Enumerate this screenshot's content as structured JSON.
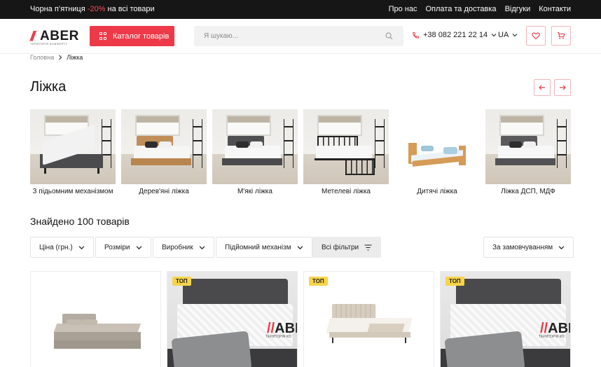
{
  "topbar": {
    "promo_prefix": "Чорна п’ятниця ",
    "promo_discount": "-20%",
    "promo_suffix": " на всі товари",
    "nav": [
      "Про нас",
      "Оплата та доставка",
      "Відгуки",
      "Контакти"
    ]
  },
  "header": {
    "logo_text": "ABER",
    "logo_tagline": "ТЕРИТОРІЯ КОМФОРТУ",
    "catalog_label": "Каталог товарів",
    "search_placeholder": "Я шукаю...",
    "phone": "+38 082 221 22 14",
    "language": "UA",
    "colors": {
      "accent": "#ee3a48",
      "dark": "#161616"
    }
  },
  "breadcrumb": {
    "home": "Головна",
    "current": "Ліжка"
  },
  "page": {
    "title": "Ліжка"
  },
  "categories": [
    {
      "label": "З підьомним механізмом"
    },
    {
      "label": "Дерев'яні ліжка"
    },
    {
      "label": "М'які ліжка"
    },
    {
      "label": "Метелеві ліжка"
    },
    {
      "label": "Дитячі ліжка"
    },
    {
      "label": "Ліжка ДСП, МДФ"
    }
  ],
  "results": {
    "found_text": "Знайдено 100 товарів"
  },
  "filters": {
    "price": "Ціна (грн.)",
    "sizes": "Розміри",
    "manufacturer": "Виробник",
    "lift": "Підйомний механізм",
    "all": "Всі фільтри",
    "sort": "За замовчуванням"
  },
  "products": [
    {
      "badge": ""
    },
    {
      "badge": "ТОП",
      "watermark": "ABER",
      "watermark_tag": "ТЕРИТОРІЯ КО"
    },
    {
      "badge": "ТОП"
    },
    {
      "badge": "ТОП",
      "watermark": "ABER",
      "watermark_tag": "ТЕРИТОРІЯ КО"
    }
  ],
  "icons": {
    "catalog": "grid-icon",
    "search": "search-icon",
    "phone": "phone-icon",
    "wishlist": "heart-icon",
    "cart": "cart-icon",
    "prev": "arrow-left-icon",
    "next": "arrow-right-icon",
    "filter": "filter-lines-icon"
  }
}
